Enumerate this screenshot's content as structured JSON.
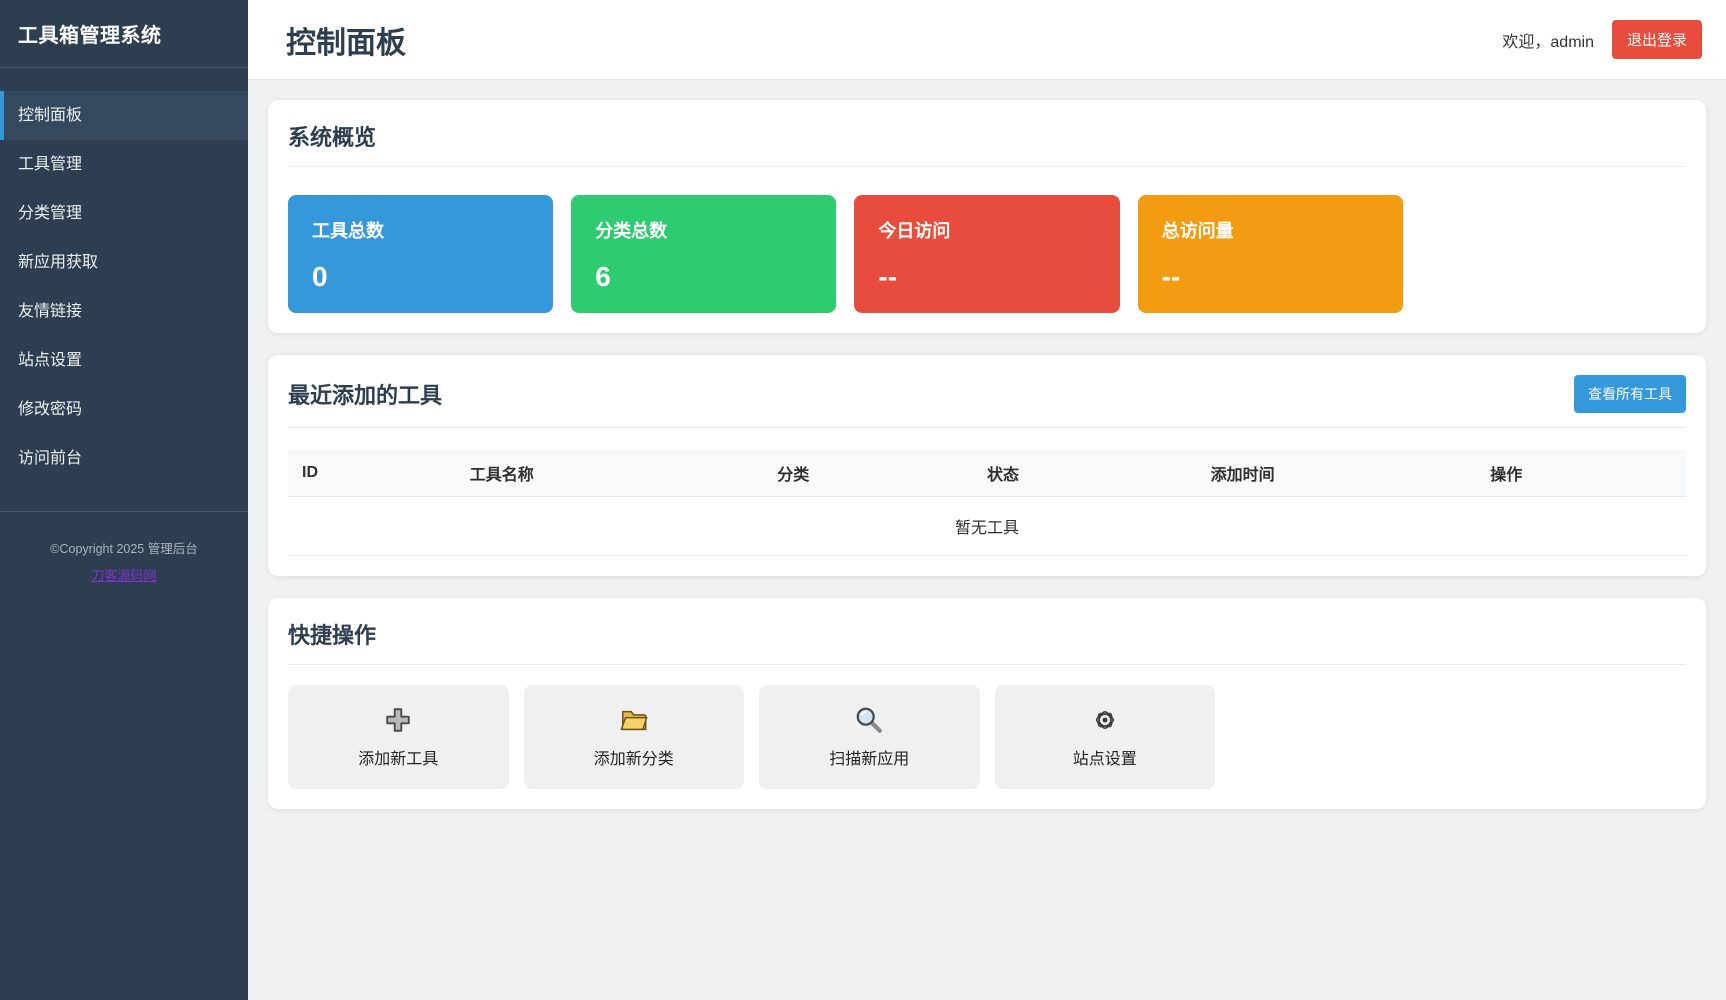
{
  "app": {
    "title": "工具箱管理系统"
  },
  "sidebar": {
    "items": [
      {
        "label": "控制面板",
        "active": true
      },
      {
        "label": "工具管理",
        "active": false
      },
      {
        "label": "分类管理",
        "active": false
      },
      {
        "label": "新应用获取",
        "active": false
      },
      {
        "label": "友情链接",
        "active": false
      },
      {
        "label": "站点设置",
        "active": false
      },
      {
        "label": "修改密码",
        "active": false
      },
      {
        "label": "访问前台",
        "active": false
      }
    ],
    "footer": {
      "copyright": "©Copyright 2025 管理后台",
      "link_label": "刀客源码网"
    }
  },
  "header": {
    "title": "控制面板",
    "welcome": "欢迎，admin",
    "logout_label": "退出登录"
  },
  "overview": {
    "title": "系统概览",
    "stats": [
      {
        "label": "工具总数",
        "value": "0",
        "color": "#3498db"
      },
      {
        "label": "分类总数",
        "value": "6",
        "color": "#2ecc71"
      },
      {
        "label": "今日访问",
        "value": "--",
        "color": "#e74c3c"
      },
      {
        "label": "总访问量",
        "value": "--",
        "color": "#f39c12"
      }
    ]
  },
  "recent_tools": {
    "title": "最近添加的工具",
    "view_all_label": "查看所有工具",
    "columns": [
      "ID",
      "工具名称",
      "分类",
      "状态",
      "添加时间",
      "操作"
    ],
    "empty_text": "暂无工具",
    "rows": []
  },
  "quick_actions": {
    "title": "快捷操作",
    "items": [
      {
        "label": "添加新工具",
        "icon": "plus-icon"
      },
      {
        "label": "添加新分类",
        "icon": "folder-icon"
      },
      {
        "label": "扫描新应用",
        "icon": "search-icon"
      },
      {
        "label": "站点设置",
        "icon": "gear-icon"
      }
    ]
  },
  "colors": {
    "sidebar_bg": "#2c3e50",
    "sidebar_active_bg": "#34495e",
    "accent_blue": "#3498db",
    "success_green": "#2ecc71",
    "danger_red": "#e74c3c",
    "warning_orange": "#f39c12",
    "footer_link_purple": "#7d33cc",
    "main_bg": "#f0f1f2"
  }
}
